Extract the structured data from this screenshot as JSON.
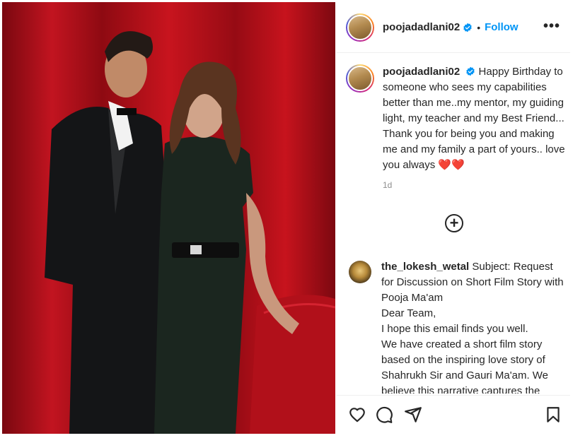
{
  "post": {
    "username": "poojadadlani02",
    "follow_label": "Follow",
    "dot": "•",
    "more_label": "•••"
  },
  "caption": {
    "username": "poojadadlani02",
    "text": "Happy Birthday to someone who sees my capabilities better than me..my mentor, my guiding light, my teacher and my Best Friend... Thank you for being you and making me and my family a part of yours.. love you always ❤️❤️",
    "time": "1d"
  },
  "load_more_icon": "plus-circle-icon",
  "comment": {
    "username": "the_lokesh_wetal",
    "lines": [
      "Subject: Request for Discussion on Short Film Story with Pooja Ma'am",
      "Dear Team,",
      "I hope this email finds you well.",
      "We have created a short film story based on the inspiring love story of Shahrukh Sir and Gauri Ma'am. We believe this narrative captures the essence of their"
    ]
  },
  "actions": {
    "like_icon": "heart-icon",
    "comment_icon": "comment-icon",
    "share_icon": "share-icon",
    "save_icon": "bookmark-icon"
  },
  "colors": {
    "accent": "#0095f6",
    "verified": "#0095f6",
    "backdrop": "#a50c14"
  }
}
